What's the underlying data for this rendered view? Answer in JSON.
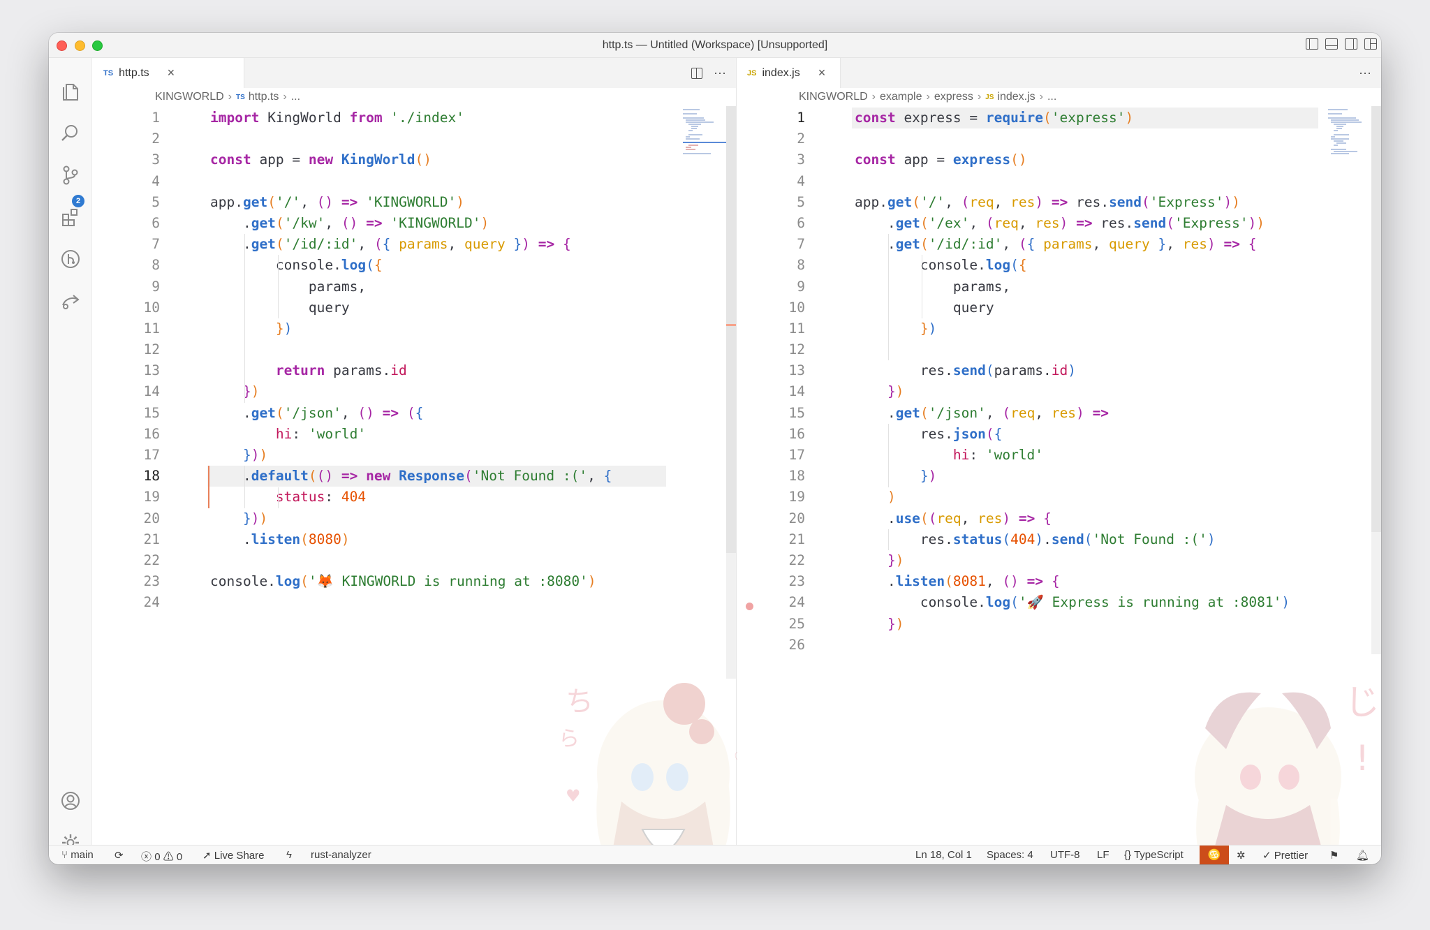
{
  "window": {
    "title": "http.ts — Untitled (Workspace) [Unsupported]"
  },
  "activitybar": {
    "source_control_badge": "2"
  },
  "left": {
    "tab": {
      "lang": "TS",
      "label": "http.ts"
    },
    "breadcrumb": {
      "root": "KINGWORLD",
      "lang": "TS",
      "file": "http.ts",
      "more": "..."
    },
    "line_numbers": [
      "1",
      "2",
      "3",
      "4",
      "5",
      "6",
      "7",
      "8",
      "9",
      "10",
      "11",
      "12",
      "13",
      "14",
      "15",
      "16",
      "17",
      "18",
      "19",
      "20",
      "21",
      "22",
      "23",
      "24"
    ]
  },
  "right": {
    "tab": {
      "lang": "JS",
      "label": "index.js"
    },
    "breadcrumb": {
      "root": "KINGWORLD",
      "folder1": "example",
      "folder2": "express",
      "lang": "JS",
      "file": "index.js",
      "more": "..."
    },
    "line_numbers": [
      "1",
      "2",
      "3",
      "4",
      "5",
      "6",
      "7",
      "8",
      "9",
      "10",
      "11",
      "12",
      "13",
      "14",
      "15",
      "16",
      "17",
      "18",
      "19",
      "20",
      "21",
      "22",
      "23",
      "24",
      "25",
      "26"
    ]
  },
  "code": {
    "left": [
      [
        [
          "kw",
          "import"
        ],
        [
          "plain",
          " KingWorld "
        ],
        [
          "kw",
          "from"
        ],
        [
          "str",
          " './index'"
        ]
      ],
      [],
      [
        [
          "kw",
          "const"
        ],
        [
          "plain",
          " app = "
        ],
        [
          "kw",
          "new"
        ],
        [
          "plain",
          " "
        ],
        [
          "fn",
          "KingWorld"
        ],
        [
          "pa",
          "()"
        ]
      ],
      [],
      [
        [
          "plain",
          "app."
        ],
        [
          "fn",
          "get"
        ],
        [
          "pa",
          "("
        ],
        [
          "str",
          "'/'"
        ],
        [
          "plain",
          ", "
        ],
        [
          "pb",
          "()"
        ],
        [
          "plain",
          " "
        ],
        [
          "kw",
          "=>"
        ],
        [
          "str",
          " 'KINGWORLD'"
        ],
        [
          "pa",
          ")"
        ]
      ],
      [
        [
          "plain",
          "    ."
        ],
        [
          "fn",
          "get"
        ],
        [
          "pa",
          "("
        ],
        [
          "str",
          "'/kw'"
        ],
        [
          "plain",
          ", "
        ],
        [
          "pb",
          "()"
        ],
        [
          "plain",
          " "
        ],
        [
          "kw",
          "=>"
        ],
        [
          "str",
          " 'KINGWORLD'"
        ],
        [
          "pa",
          ")"
        ]
      ],
      [
        [
          "plain",
          "    ."
        ],
        [
          "fn",
          "get"
        ],
        [
          "pa",
          "("
        ],
        [
          "str",
          "'/id/:id'"
        ],
        [
          "plain",
          ", "
        ],
        [
          "pb",
          "("
        ],
        [
          "pc",
          "{"
        ],
        [
          "plain",
          " "
        ],
        [
          "param",
          "params"
        ],
        [
          "plain",
          ", "
        ],
        [
          "param",
          "query"
        ],
        [
          "plain",
          " "
        ],
        [
          "pc",
          "}"
        ],
        [
          "pb",
          ")"
        ],
        [
          "plain",
          " "
        ],
        [
          "kw",
          "=>"
        ],
        [
          "plain",
          " "
        ],
        [
          "pb",
          "{"
        ]
      ],
      [
        [
          "plain",
          "        console."
        ],
        [
          "fn",
          "log"
        ],
        [
          "pc",
          "("
        ],
        [
          "pa",
          "{"
        ]
      ],
      [
        [
          "plain",
          "            params,"
        ]
      ],
      [
        [
          "plain",
          "            query"
        ]
      ],
      [
        [
          "plain",
          "        "
        ],
        [
          "pa",
          "}"
        ],
        [
          "pc",
          ")"
        ]
      ],
      [],
      [
        [
          "plain",
          "        "
        ],
        [
          "kw",
          "return"
        ],
        [
          "plain",
          " params."
        ],
        [
          "prop",
          "id"
        ]
      ],
      [
        [
          "plain",
          "    "
        ],
        [
          "pb",
          "}"
        ],
        [
          "pa",
          ")"
        ]
      ],
      [
        [
          "plain",
          "    ."
        ],
        [
          "fn",
          "get"
        ],
        [
          "pa",
          "("
        ],
        [
          "str",
          "'/json'"
        ],
        [
          "plain",
          ", "
        ],
        [
          "pb",
          "()"
        ],
        [
          "plain",
          " "
        ],
        [
          "kw",
          "=>"
        ],
        [
          "plain",
          " "
        ],
        [
          "pb",
          "("
        ],
        [
          "pc",
          "{"
        ]
      ],
      [
        [
          "plain",
          "        "
        ],
        [
          "prop",
          "hi"
        ],
        [
          "plain",
          ": "
        ],
        [
          "str",
          "'world'"
        ]
      ],
      [
        [
          "plain",
          "    "
        ],
        [
          "pc",
          "}"
        ],
        [
          "pb",
          ")"
        ],
        [
          "pa",
          ")"
        ]
      ],
      [
        [
          "plain",
          "    ."
        ],
        [
          "fn",
          "default"
        ],
        [
          "pa",
          "("
        ],
        [
          "pb",
          "()"
        ],
        [
          "plain",
          " "
        ],
        [
          "kw",
          "=>"
        ],
        [
          "plain",
          " "
        ],
        [
          "kw",
          "new"
        ],
        [
          "plain",
          " "
        ],
        [
          "fn",
          "Response"
        ],
        [
          "pb",
          "("
        ],
        [
          "str",
          "'Not Found :('"
        ],
        [
          "plain",
          ", "
        ],
        [
          "pc",
          "{"
        ]
      ],
      [
        [
          "plain",
          "        "
        ],
        [
          "prop",
          "status"
        ],
        [
          "plain",
          ": "
        ],
        [
          "num",
          "404"
        ]
      ],
      [
        [
          "plain",
          "    "
        ],
        [
          "pc",
          "}"
        ],
        [
          "pb",
          ")"
        ],
        [
          "pa",
          ")"
        ]
      ],
      [
        [
          "plain",
          "    ."
        ],
        [
          "fn",
          "listen"
        ],
        [
          "pa",
          "("
        ],
        [
          "num",
          "8080"
        ],
        [
          "pa",
          ")"
        ]
      ],
      [],
      [
        [
          "plain",
          "console."
        ],
        [
          "fn",
          "log"
        ],
        [
          "pa",
          "("
        ],
        [
          "str",
          "'🦊 KINGWORLD is running at :8080'"
        ],
        [
          "pa",
          ")"
        ]
      ],
      []
    ],
    "right": [
      [
        [
          "kw",
          "const"
        ],
        [
          "plain",
          " express = "
        ],
        [
          "fn",
          "require"
        ],
        [
          "pa",
          "("
        ],
        [
          "str",
          "'express'"
        ],
        [
          "pa",
          ")"
        ]
      ],
      [],
      [
        [
          "kw",
          "const"
        ],
        [
          "plain",
          " app = "
        ],
        [
          "fn",
          "express"
        ],
        [
          "pa",
          "()"
        ]
      ],
      [],
      [
        [
          "plain",
          "app."
        ],
        [
          "fn",
          "get"
        ],
        [
          "pa",
          "("
        ],
        [
          "str",
          "'/'"
        ],
        [
          "plain",
          ", "
        ],
        [
          "pb",
          "("
        ],
        [
          "param",
          "req"
        ],
        [
          "plain",
          ", "
        ],
        [
          "param",
          "res"
        ],
        [
          "pb",
          ")"
        ],
        [
          "plain",
          " "
        ],
        [
          "kw",
          "=>"
        ],
        [
          "plain",
          " res."
        ],
        [
          "fn",
          "send"
        ],
        [
          "pb",
          "("
        ],
        [
          "str",
          "'Express'"
        ],
        [
          "pb",
          ")"
        ],
        [
          "pa",
          ")"
        ]
      ],
      [
        [
          "plain",
          "    ."
        ],
        [
          "fn",
          "get"
        ],
        [
          "pa",
          "("
        ],
        [
          "str",
          "'/ex'"
        ],
        [
          "plain",
          ", "
        ],
        [
          "pb",
          "("
        ],
        [
          "param",
          "req"
        ],
        [
          "plain",
          ", "
        ],
        [
          "param",
          "res"
        ],
        [
          "pb",
          ")"
        ],
        [
          "plain",
          " "
        ],
        [
          "kw",
          "=>"
        ],
        [
          "plain",
          " res."
        ],
        [
          "fn",
          "send"
        ],
        [
          "pb",
          "("
        ],
        [
          "str",
          "'Express'"
        ],
        [
          "pb",
          ")"
        ],
        [
          "pa",
          ")"
        ]
      ],
      [
        [
          "plain",
          "    ."
        ],
        [
          "fn",
          "get"
        ],
        [
          "pa",
          "("
        ],
        [
          "str",
          "'/id/:id'"
        ],
        [
          "plain",
          ", "
        ],
        [
          "pb",
          "("
        ],
        [
          "pc",
          "{"
        ],
        [
          "plain",
          " "
        ],
        [
          "param",
          "params"
        ],
        [
          "plain",
          ", "
        ],
        [
          "param",
          "query"
        ],
        [
          "plain",
          " "
        ],
        [
          "pc",
          "}"
        ],
        [
          "plain",
          ", "
        ],
        [
          "param",
          "res"
        ],
        [
          "pb",
          ")"
        ],
        [
          "plain",
          " "
        ],
        [
          "kw",
          "=>"
        ],
        [
          "plain",
          " "
        ],
        [
          "pb",
          "{"
        ]
      ],
      [
        [
          "plain",
          "        console."
        ],
        [
          "fn",
          "log"
        ],
        [
          "pc",
          "("
        ],
        [
          "pa",
          "{"
        ]
      ],
      [
        [
          "plain",
          "            params,"
        ]
      ],
      [
        [
          "plain",
          "            query"
        ]
      ],
      [
        [
          "plain",
          "        "
        ],
        [
          "pa",
          "}"
        ],
        [
          "pc",
          ")"
        ]
      ],
      [],
      [
        [
          "plain",
          "        res."
        ],
        [
          "fn",
          "send"
        ],
        [
          "pc",
          "("
        ],
        [
          "plain",
          "params."
        ],
        [
          "prop",
          "id"
        ],
        [
          "pc",
          ")"
        ]
      ],
      [
        [
          "plain",
          "    "
        ],
        [
          "pb",
          "}"
        ],
        [
          "pa",
          ")"
        ]
      ],
      [
        [
          "plain",
          "    ."
        ],
        [
          "fn",
          "get"
        ],
        [
          "pa",
          "("
        ],
        [
          "str",
          "'/json'"
        ],
        [
          "plain",
          ", "
        ],
        [
          "pb",
          "("
        ],
        [
          "param",
          "req"
        ],
        [
          "plain",
          ", "
        ],
        [
          "param",
          "res"
        ],
        [
          "pb",
          ")"
        ],
        [
          "plain",
          " "
        ],
        [
          "kw",
          "=>"
        ]
      ],
      [
        [
          "plain",
          "        res."
        ],
        [
          "fn",
          "json"
        ],
        [
          "pb",
          "("
        ],
        [
          "pc",
          "{"
        ]
      ],
      [
        [
          "plain",
          "            "
        ],
        [
          "prop",
          "hi"
        ],
        [
          "plain",
          ": "
        ],
        [
          "str",
          "'world'"
        ]
      ],
      [
        [
          "plain",
          "        "
        ],
        [
          "pc",
          "}"
        ],
        [
          "pb",
          ")"
        ]
      ],
      [
        [
          "plain",
          "    "
        ],
        [
          "pa",
          ")"
        ]
      ],
      [
        [
          "plain",
          "    ."
        ],
        [
          "fn",
          "use"
        ],
        [
          "pa",
          "("
        ],
        [
          "pb",
          "("
        ],
        [
          "param",
          "req"
        ],
        [
          "plain",
          ", "
        ],
        [
          "param",
          "res"
        ],
        [
          "pb",
          ")"
        ],
        [
          "plain",
          " "
        ],
        [
          "kw",
          "=>"
        ],
        [
          "plain",
          " "
        ],
        [
          "pb",
          "{"
        ]
      ],
      [
        [
          "plain",
          "        res."
        ],
        [
          "fn",
          "status"
        ],
        [
          "pc",
          "("
        ],
        [
          "num",
          "404"
        ],
        [
          "pc",
          ")"
        ],
        [
          "plain",
          "."
        ],
        [
          "fn",
          "send"
        ],
        [
          "pc",
          "("
        ],
        [
          "str",
          "'Not Found :('"
        ],
        [
          "pc",
          ")"
        ]
      ],
      [
        [
          "plain",
          "    "
        ],
        [
          "pb",
          "}"
        ],
        [
          "pa",
          ")"
        ]
      ],
      [
        [
          "plain",
          "    ."
        ],
        [
          "fn",
          "listen"
        ],
        [
          "pa",
          "("
        ],
        [
          "num",
          "8081"
        ],
        [
          "plain",
          ", "
        ],
        [
          "pb",
          "()"
        ],
        [
          "plain",
          " "
        ],
        [
          "kw",
          "=>"
        ],
        [
          "plain",
          " "
        ],
        [
          "pb",
          "{"
        ]
      ],
      [
        [
          "plain",
          "        console."
        ],
        [
          "fn",
          "log"
        ],
        [
          "pc",
          "("
        ],
        [
          "str",
          "'🚀 Express is running at :8081'"
        ],
        [
          "pc",
          ")"
        ]
      ],
      [
        [
          "plain",
          "    "
        ],
        [
          "pb",
          "}"
        ],
        [
          "pa",
          ")"
        ]
      ],
      []
    ]
  },
  "statusbar": {
    "branch": "main",
    "errors": "0",
    "warnings": "0",
    "live_share": "Live Share",
    "analyzer": "rust-analyzer",
    "position": "Ln 18, Col 1",
    "spaces": "Spaces: 4",
    "encoding": "UTF-8",
    "eol": "LF",
    "language": "TypeScript",
    "prettier": "Prettier"
  },
  "colors": {
    "accent_statusbar": "#cc4d1a",
    "keyword": "#a626a4",
    "function": "#2f6fc8",
    "string": "#2e7d32",
    "number": "#e65100"
  }
}
